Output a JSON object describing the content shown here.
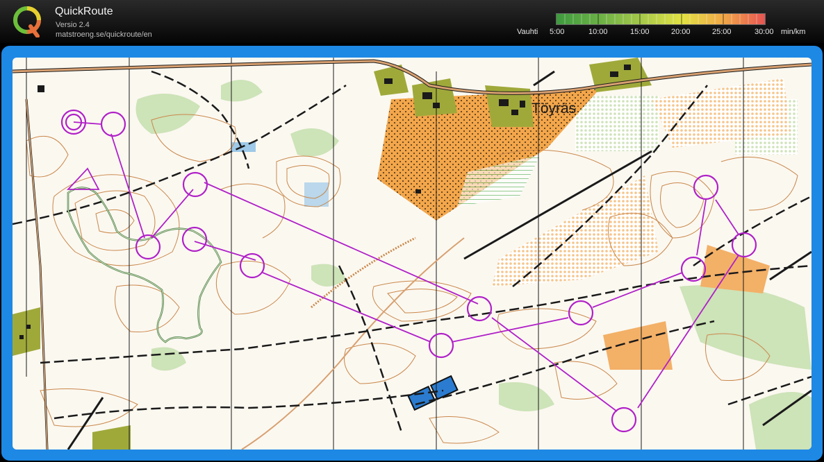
{
  "app": {
    "title": "QuickRoute",
    "version": "Versio 2.4",
    "url": "matstroeng.se/quickroute/en",
    "logo_letter": "Q"
  },
  "pace_legend": {
    "label": "Vauhti",
    "ticks": [
      "5:00",
      "10:00",
      "15:00",
      "20:00",
      "25:00",
      "30:00"
    ],
    "unit": "min/km",
    "colors": [
      "#3fa03f",
      "#7fbf3f",
      "#c8d84a",
      "#e8e040",
      "#f0a040",
      "#e85050"
    ]
  },
  "map": {
    "place_name": "Töyräs",
    "frame_color": "#1e88e5",
    "course_color": "#b020c8",
    "route_color": "#3a7a3a",
    "controls": [
      {
        "id": "start"
      },
      {
        "id": "1"
      },
      {
        "id": "2"
      },
      {
        "id": "3"
      },
      {
        "id": "4"
      },
      {
        "id": "5"
      },
      {
        "id": "6"
      },
      {
        "id": "7"
      },
      {
        "id": "8"
      },
      {
        "id": "9"
      },
      {
        "id": "10"
      },
      {
        "id": "11"
      },
      {
        "id": "12"
      }
    ]
  }
}
